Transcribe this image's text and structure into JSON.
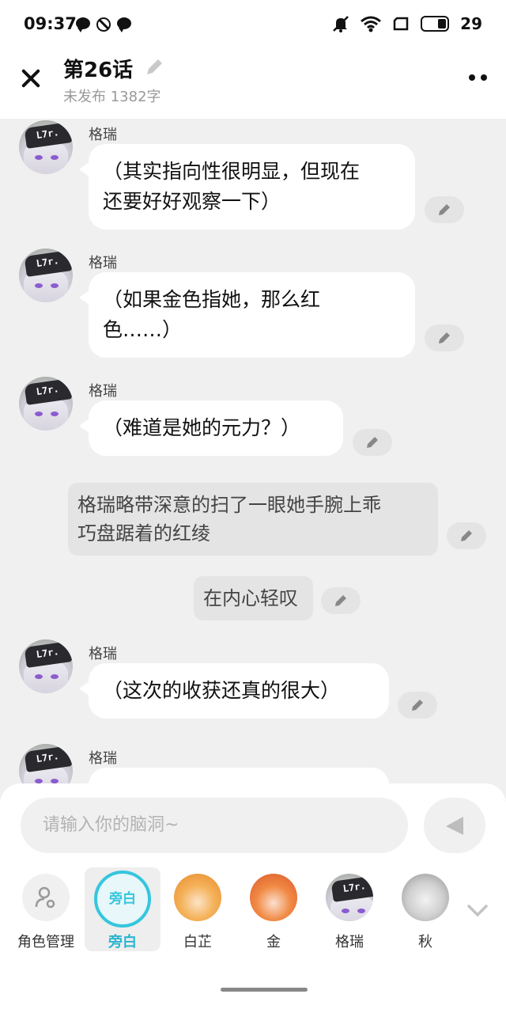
{
  "status_bar": {
    "time": "09:37",
    "battery": "29"
  },
  "header": {
    "title": "第26话",
    "subtitle": "未发布 1382字"
  },
  "messages": [
    {
      "type": "character",
      "speaker": "格瑞",
      "lines": [
        "（其实指向性很明显，但现在",
        "还要好好观察一下）"
      ]
    },
    {
      "type": "character",
      "speaker": "格瑞",
      "lines": [
        "（如果金色指她，那么红",
        "色……）"
      ]
    },
    {
      "type": "character",
      "speaker": "格瑞",
      "lines": [
        "（难道是她的元力？）"
      ]
    },
    {
      "type": "narration",
      "lines": [
        "格瑞略带深意的扫了一眼她手腕上乖",
        "巧盘踞着的红绫"
      ]
    },
    {
      "type": "narration",
      "lines": [
        "在内心轻叹"
      ]
    },
    {
      "type": "character",
      "speaker": "格瑞",
      "lines": [
        "（这次的收获还真的很大）"
      ]
    },
    {
      "type": "character",
      "speaker": "格瑞",
      "lines": [
        ""
      ]
    }
  ],
  "composer": {
    "placeholder": "请输入你的脑洞~"
  },
  "roles": [
    {
      "label": "角色管理",
      "icon": "role-manage-icon"
    },
    {
      "label": "旁白",
      "circle_text": "旁白",
      "selected": true
    },
    {
      "label": "白芷"
    },
    {
      "label": "金"
    },
    {
      "label": "格瑞"
    },
    {
      "label": "秋"
    }
  ],
  "colors": {
    "accent": "#35c6dd",
    "chat_bg": "#f0f0f0",
    "bubble": "#ffffff",
    "narration_bg": "#e4e4e4"
  }
}
